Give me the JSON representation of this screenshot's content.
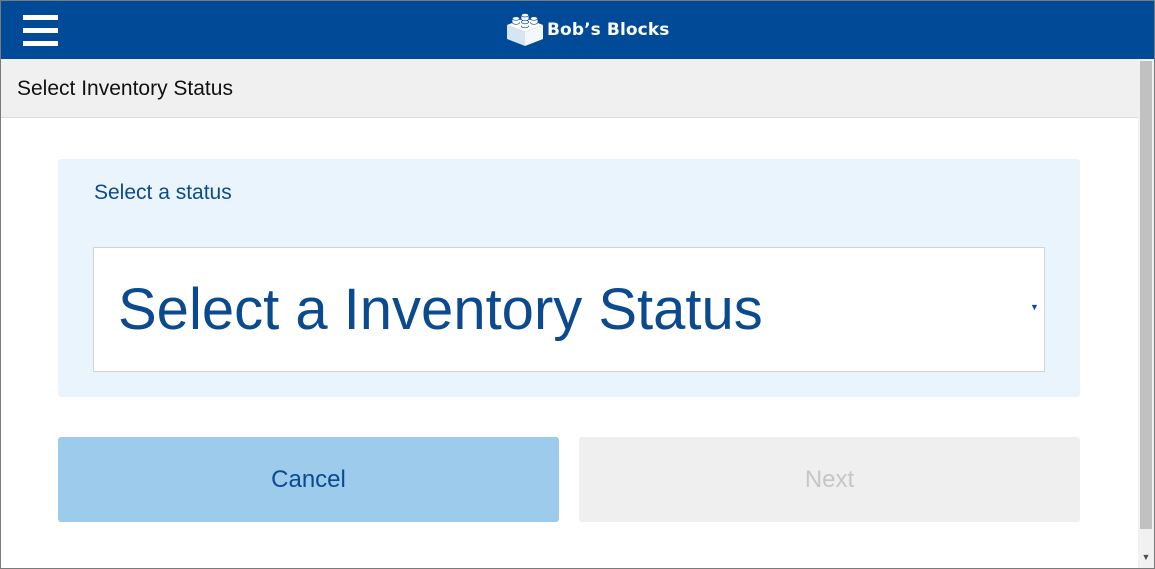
{
  "header": {
    "menu_icon": "hamburger-menu-icon",
    "logo_icon": "lego-brick-icon",
    "brand_name": "Bob’s Blocks",
    "background_color": "#004a97"
  },
  "page": {
    "title": "Select Inventory Status"
  },
  "form": {
    "label": "Select a status",
    "select_value": "Select a Inventory Status",
    "caret_icon": "caret-down-icon",
    "panel_color": "#eaf4fd",
    "text_color": "#0b4a8e"
  },
  "actions": {
    "cancel_label": "Cancel",
    "next_label": "Next",
    "cancel_color": "#9ccbeb",
    "next_disabled": true
  },
  "scrollbar": {
    "down_arrow_icon": "scroll-down-arrow-icon"
  }
}
